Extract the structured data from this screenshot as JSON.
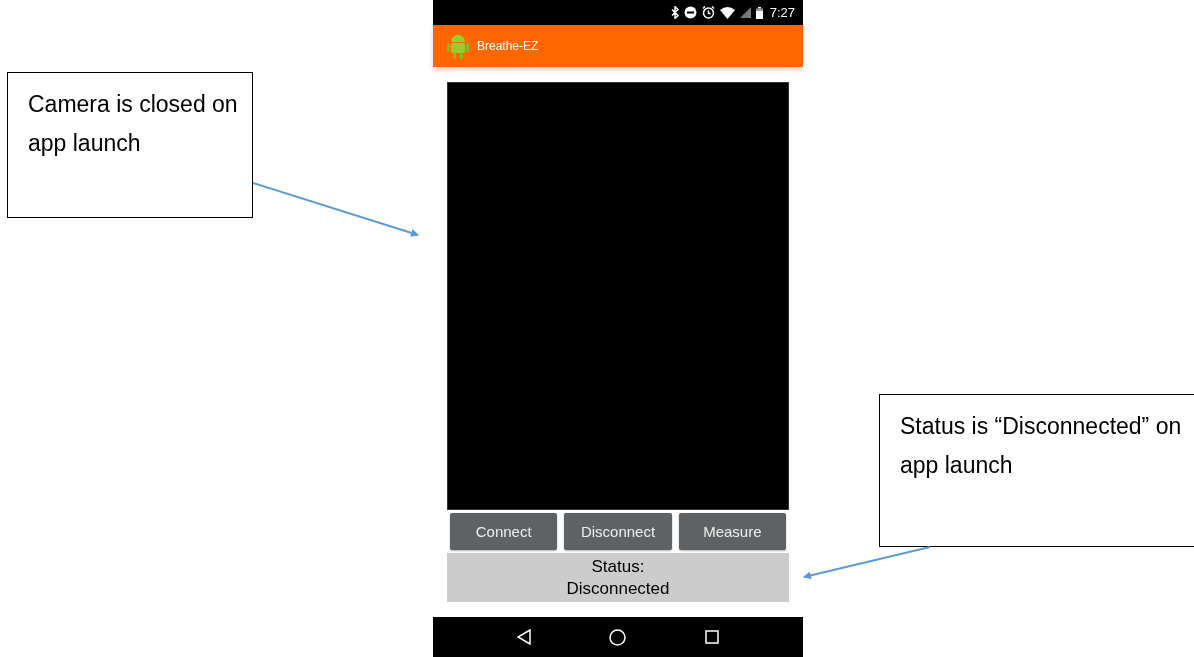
{
  "status_bar": {
    "time": "7:27"
  },
  "app_bar": {
    "title": "Breathe-EZ"
  },
  "buttons": [
    "Connect",
    "Disconnect",
    "Measure"
  ],
  "status": {
    "label": "Status:",
    "value": "Disconnected"
  },
  "annotations": [
    {
      "text": "Camera is closed on app launch"
    },
    {
      "text": "Status is “Disconnected” on app launch"
    }
  ]
}
